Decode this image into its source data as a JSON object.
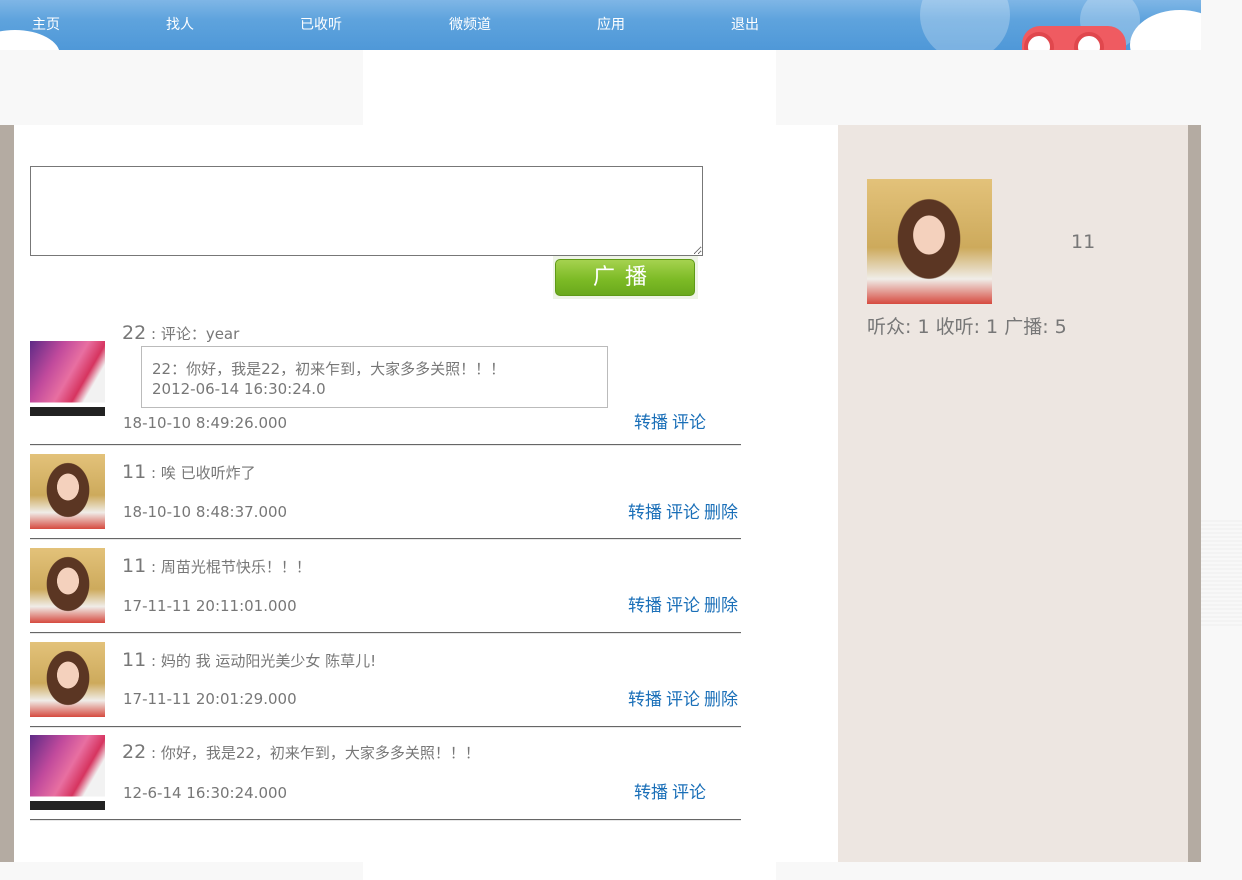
{
  "nav": [
    "主页",
    "找人",
    "已收听",
    "微频道",
    "应用",
    "退出"
  ],
  "compose": {
    "button_label": "广播"
  },
  "posts": [
    {
      "author": "22",
      "sep": ":",
      "text": "评论：year",
      "quote": {
        "line1": "22：你好，我是22，初来乍到，大家多多关照！！！",
        "line2": "2012-06-14 16:30:24.0"
      },
      "time": "18-10-10 8:49:26.000",
      "forward": "转播",
      "comment": "评论"
    },
    {
      "author": "11",
      "sep": ":",
      "text": "唉 已收听炸了",
      "time": "18-10-10 8:48:37.000",
      "forward": "转播",
      "comment": "评论",
      "delete": "删除"
    },
    {
      "author": "11",
      "sep": ":",
      "text": "周苗光棍节快乐！！！",
      "time": "17-11-11 20:11:01.000",
      "forward": "转播",
      "comment": "评论",
      "delete": "删除"
    },
    {
      "author": "11",
      "sep": ":",
      "text": "妈的 我 运动阳光美少女 陈草儿!",
      "time": "17-11-11 20:01:29.000",
      "forward": "转播",
      "comment": "评论",
      "delete": "删除"
    },
    {
      "author": "22",
      "sep": ":",
      "text": "你好，我是22，初来乍到，大家多多关照！！！",
      "time": "12-6-14 16:30:24.000",
      "forward": "转播",
      "comment": "评论"
    }
  ],
  "profile": {
    "name": "11",
    "listeners_label": "听众:",
    "listeners": "1",
    "following_label": "收听:",
    "following": "1",
    "broadcasts_label": "广播:",
    "broadcasts": "5"
  },
  "colors": {
    "link": "#1a6fb8",
    "sidebar": "#ede6e1",
    "border": "#b4aba2",
    "button": "#7dbb26"
  }
}
